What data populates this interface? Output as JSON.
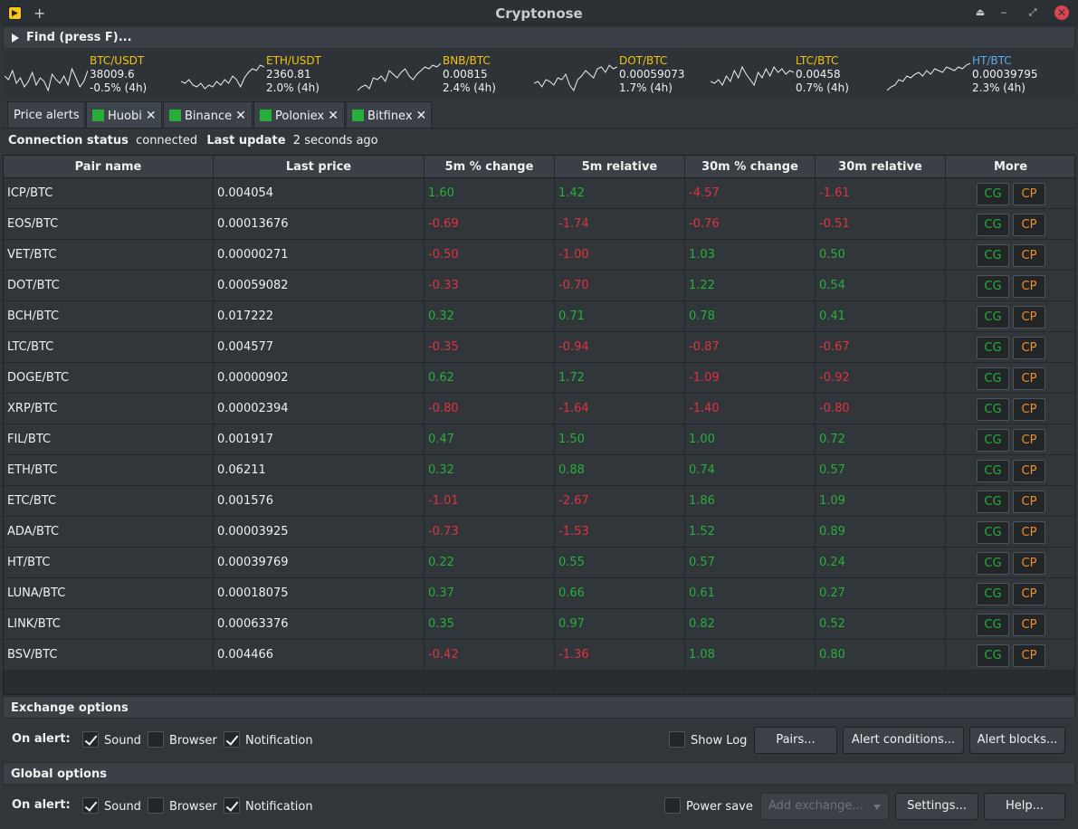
{
  "window": {
    "title": "Cryptonose",
    "plus": "+"
  },
  "find": {
    "label": "Find (press F)..."
  },
  "tickers": [
    {
      "pair": "BTC/USDT",
      "price": "38009.6",
      "change": "-0.5% (4h)",
      "color": "#f4c20d",
      "spark": [
        18,
        22,
        12,
        26,
        20,
        30,
        24,
        14,
        28,
        20,
        24,
        34,
        16,
        22,
        26,
        18,
        28,
        10,
        20,
        30,
        24,
        12
      ]
    },
    {
      "pair": "ETH/USDT",
      "price": "2360.81",
      "change": "2.0% (4h)",
      "color": "#f4c20d",
      "spark": [
        24,
        26,
        22,
        28,
        30,
        26,
        32,
        28,
        30,
        24,
        28,
        22,
        26,
        18,
        22,
        30,
        20,
        14,
        10,
        12,
        6,
        8
      ]
    },
    {
      "pair": "BNB/BTC",
      "price": "0.00815",
      "change": "2.4% (4h)",
      "color": "#f4c20d",
      "spark": [
        34,
        30,
        28,
        32,
        20,
        22,
        18,
        24,
        12,
        16,
        20,
        14,
        10,
        18,
        22,
        16,
        12,
        8,
        10,
        6,
        8,
        4
      ]
    },
    {
      "pair": "DOT/BTC",
      "price": "0.00059073",
      "change": "1.7% (4h)",
      "color": "#f4c20d",
      "spark": [
        26,
        24,
        30,
        22,
        24,
        28,
        20,
        22,
        16,
        28,
        34,
        22,
        18,
        12,
        16,
        20,
        10,
        8,
        14,
        6,
        10,
        8
      ]
    },
    {
      "pair": "LTC/BTC",
      "price": "0.00458",
      "change": "0.7% (4h)",
      "color": "#f4c20d",
      "spark": [
        24,
        26,
        22,
        28,
        18,
        24,
        12,
        20,
        8,
        16,
        22,
        28,
        14,
        20,
        10,
        18,
        8,
        14,
        10,
        16,
        12,
        14
      ]
    },
    {
      "pair": "HT/BTC",
      "price": "0.00039795",
      "change": "2.3% (4h)",
      "color": "#62a8ea",
      "spark": [
        34,
        30,
        28,
        22,
        24,
        18,
        20,
        16,
        14,
        18,
        12,
        16,
        10,
        12,
        14,
        8,
        10,
        12,
        8,
        10,
        6,
        4
      ]
    }
  ],
  "tabs": [
    {
      "label": "Price alerts",
      "indicator": false,
      "closable": false
    },
    {
      "label": "Huobi",
      "indicator": true,
      "closable": true
    },
    {
      "label": "Binance",
      "indicator": true,
      "closable": true
    },
    {
      "label": "Poloniex",
      "indicator": true,
      "closable": true
    },
    {
      "label": "Bitfinex",
      "indicator": true,
      "closable": true
    }
  ],
  "tab_close": "✕",
  "status": {
    "connection_label": "Connection status",
    "connection_value": "connected",
    "update_label": "Last update",
    "update_value": "2 seconds ago"
  },
  "table": {
    "columns": [
      "Pair name",
      "Last price",
      "5m % change",
      "5m relative",
      "30m % change",
      "30m relative",
      "More"
    ],
    "buttons": {
      "cg": "CG",
      "cp": "CP"
    },
    "rows": [
      [
        "ICP/BTC",
        "0.004054",
        "1.60",
        "1.42",
        "-4.57",
        "-1.61"
      ],
      [
        "EOS/BTC",
        "0.00013676",
        "-0.69",
        "-1.74",
        "-0.76",
        "-0.51"
      ],
      [
        "VET/BTC",
        "0.00000271",
        "-0.50",
        "-1.00",
        "1.03",
        "0.50"
      ],
      [
        "DOT/BTC",
        "0.00059082",
        "-0.33",
        "-0.70",
        "1.22",
        "0.54"
      ],
      [
        "BCH/BTC",
        "0.017222",
        "0.32",
        "0.71",
        "0.78",
        "0.41"
      ],
      [
        "LTC/BTC",
        "0.004577",
        "-0.35",
        "-0.94",
        "-0.87",
        "-0.67"
      ],
      [
        "DOGE/BTC",
        "0.00000902",
        "0.62",
        "1.72",
        "-1.09",
        "-0.92"
      ],
      [
        "XRP/BTC",
        "0.00002394",
        "-0.80",
        "-1.64",
        "-1.40",
        "-0.80"
      ],
      [
        "FIL/BTC",
        "0.001917",
        "0.47",
        "1.50",
        "1.00",
        "0.72"
      ],
      [
        "ETH/BTC",
        "0.06211",
        "0.32",
        "0.88",
        "0.74",
        "0.57"
      ],
      [
        "ETC/BTC",
        "0.001576",
        "-1.01",
        "-2.67",
        "1.86",
        "1.09"
      ],
      [
        "ADA/BTC",
        "0.00003925",
        "-0.73",
        "-1.53",
        "1.52",
        "0.89"
      ],
      [
        "HT/BTC",
        "0.00039769",
        "0.22",
        "0.55",
        "0.57",
        "0.24"
      ],
      [
        "LUNA/BTC",
        "0.00018075",
        "0.37",
        "0.66",
        "0.61",
        "0.27"
      ],
      [
        "LINK/BTC",
        "0.00063376",
        "0.35",
        "0.97",
        "0.82",
        "0.52"
      ],
      [
        "BSV/BTC",
        "0.004466",
        "-0.42",
        "-1.36",
        "1.08",
        "0.80"
      ]
    ]
  },
  "exchange_options": {
    "title": "Exchange options",
    "on_alert": "On alert:",
    "sound": "Sound",
    "sound_checked": true,
    "browser": "Browser",
    "browser_checked": false,
    "notification": "Notification",
    "notification_checked": true,
    "show_log": "Show Log",
    "show_log_checked": false,
    "pairs_button": "Pairs...",
    "alert_conditions_button": "Alert conditions...",
    "alert_blocks_button": "Alert blocks..."
  },
  "global_options": {
    "title": "Global options",
    "on_alert": "On alert:",
    "sound": "Sound",
    "sound_checked": true,
    "browser": "Browser",
    "browser_checked": false,
    "notification": "Notification",
    "notification_checked": true,
    "power_save": "Power save",
    "power_save_checked": false,
    "add_exchange_placeholder": "Add exchange...",
    "settings_button": "Settings...",
    "help_button": "Help..."
  },
  "colors": {
    "positive": "#27ae3a",
    "negative": "#e0313e",
    "accent": "#f4c20d",
    "cp": "#f08c28"
  }
}
